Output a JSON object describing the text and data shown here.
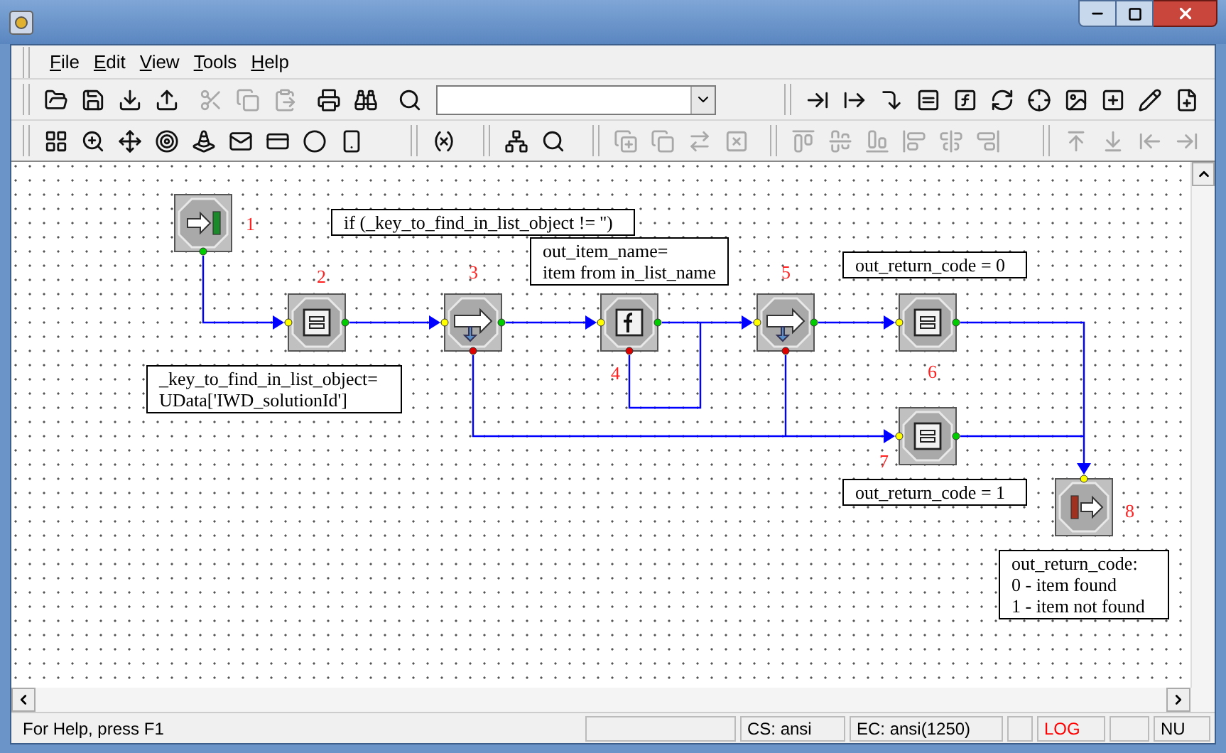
{
  "menu": [
    {
      "label": "File"
    },
    {
      "label": "Edit"
    },
    {
      "label": "View"
    },
    {
      "label": "Tools"
    },
    {
      "label": "Help"
    }
  ],
  "toolbars": [
    {
      "groups": [
        {
          "buttons": [
            {
              "disabled": false
            },
            {
              "disabled": false
            },
            {
              "disabled": false
            },
            {
              "disabled": false
            }
          ]
        },
        {
          "buttons": [
            {
              "disabled": true
            },
            {
              "disabled": true
            },
            {
              "disabled": true
            }
          ]
        },
        {
          "buttons": [
            {
              "disabled": false
            },
            {
              "disabled": false
            }
          ]
        },
        {
          "buttons": [
            {
              "disabled": false
            }
          ]
        },
        {
          "buttons": [
            {
              "disabled": false
            },
            {
              "disabled": false
            },
            {
              "disabled": false
            },
            {
              "disabled": false
            },
            {
              "disabled": false
            },
            {
              "disabled": false
            },
            {
              "disabled": false
            },
            {
              "disabled": false
            },
            {
              "disabled": false
            },
            {
              "disabled": false
            },
            {
              "disabled": false
            }
          ]
        }
      ]
    },
    {
      "groups": [
        {
          "buttons": [
            {
              "disabled": false
            },
            {
              "disabled": false
            },
            {
              "disabled": false
            },
            {
              "disabled": false
            },
            {
              "disabled": false
            },
            {
              "disabled": false
            },
            {
              "disabled": false
            },
            {
              "disabled": false
            },
            {
              "disabled": false
            }
          ]
        },
        {
          "buttons": [
            {
              "disabled": false
            }
          ]
        },
        {
          "buttons": [
            {
              "disabled": false
            },
            {
              "disabled": false
            }
          ]
        },
        {
          "buttons": [
            {
              "disabled": true
            },
            {
              "disabled": true
            },
            {
              "disabled": true
            },
            {
              "disabled": true
            }
          ]
        },
        {
          "buttons": [
            {
              "disabled": true
            },
            {
              "disabled": true
            },
            {
              "disabled": true
            },
            {
              "disabled": true
            },
            {
              "disabled": true
            },
            {
              "disabled": true
            }
          ]
        },
        {
          "buttons": [
            {
              "disabled": true
            },
            {
              "disabled": true
            },
            {
              "disabled": true
            },
            {
              "disabled": true
            }
          ]
        }
      ]
    }
  ],
  "diagram": {
    "nodes": [
      {
        "kind": "start",
        "number": "1"
      },
      {
        "kind": "assign",
        "number": "2"
      },
      {
        "kind": "branch",
        "number": "3"
      },
      {
        "kind": "function",
        "number": "4"
      },
      {
        "kind": "branch",
        "number": "5"
      },
      {
        "kind": "assign",
        "number": "6"
      },
      {
        "kind": "assign",
        "number": "7"
      },
      {
        "kind": "end",
        "number": "8"
      }
    ],
    "notes": [
      {
        "lines": [
          "if (_key_to_find_in_list_object != '')"
        ]
      },
      {
        "lines": [
          "out_item_name=",
          "item from in_list_name"
        ]
      },
      {
        "lines": [
          "_key_to_find_in_list_object=",
          "UData['IWD_solutionId']"
        ]
      },
      {
        "lines": [
          "out_return_code = 0"
        ]
      },
      {
        "lines": [
          "out_return_code = 1"
        ]
      },
      {
        "lines": [
          "out_return_code:",
          "0 - item found",
          "1 - item not found"
        ]
      }
    ]
  },
  "status_bar": [
    {
      "text": "For Help, press F1",
      "active": false
    },
    {
      "text": "CS: ansi",
      "active": false
    },
    {
      "text": "EC: ansi(1250)",
      "active": false
    },
    {
      "text": "LOG",
      "active": true
    },
    {
      "text": "NU",
      "active": false
    }
  ]
}
